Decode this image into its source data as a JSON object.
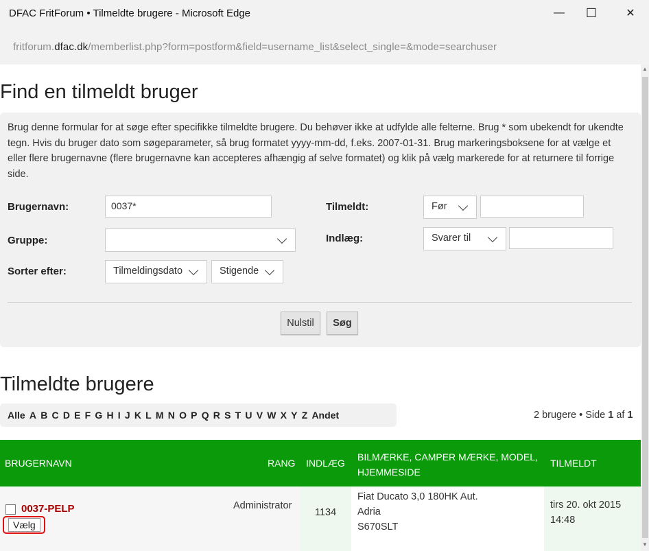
{
  "window": {
    "title": "DFAC FritForum • Tilmeldte brugere - Microsoft Edge",
    "minimize": "—",
    "maximize": "☐",
    "close": "✕"
  },
  "address": {
    "domain_prefix": "fritforum.",
    "domain": "dfac.dk",
    "path": "/memberlist.php?form=postform&field=username_list&select_single=&mode=searchuser"
  },
  "search": {
    "heading": "Find en tilmeldt bruger",
    "description": "Brug denne formular for at søge efter specifikke tilmeldte brugere. Du behøver ikke at udfylde alle felterne. Brug * som ubekendt for ukendte tegn. Hvis du bruger dato som søgeparameter, så brug formatet yyyy-mm-dd, f.eks. 2007-01-31. Brug markeringsboksene for at vælge et eller flere brugernavne (flere brugernavne kan accepteres afhængig af selve formatet) og klik på vælg markerede for at returnere til forrige side.",
    "username_label": "Brugernavn:",
    "username_value": "0037*",
    "group_label": "Gruppe:",
    "group_value": "",
    "sort_label": "Sorter efter:",
    "sort_value": "Tilmeldingsdato",
    "order_value": "Stigende",
    "joined_label": "Tilmeldt:",
    "joined_op": "Før",
    "joined_value": "",
    "posts_label": "Indlæg:",
    "posts_op": "Svarer til",
    "posts_value": "",
    "reset_button": "Nulstil",
    "search_button": "Søg"
  },
  "members": {
    "heading": "Tilmeldte brugere",
    "alphabet": [
      "Alle",
      "A",
      "B",
      "C",
      "D",
      "E",
      "F",
      "G",
      "H",
      "I",
      "J",
      "K",
      "L",
      "M",
      "N",
      "O",
      "P",
      "Q",
      "R",
      "S",
      "T",
      "U",
      "V",
      "W",
      "X",
      "Y",
      "Z",
      "Andet"
    ],
    "pager": {
      "count": "2 brugere",
      "sep": " • Side ",
      "page": "1",
      "of": " af ",
      "total": "1"
    },
    "columns": {
      "username": "BRUGERNAVN",
      "rank": "RANG",
      "posts": "INDLÆG",
      "custom": "BILMÆRKE, CAMPER MÆRKE, MODEL, HJEMMESIDE",
      "joined": "TILMELDT"
    },
    "rows": [
      {
        "username": "0037-PELP",
        "select_button": "Vælg",
        "rank": "Administrator",
        "posts": "1134",
        "custom_line1": "Fiat Ducato 3,0 180HK Aut.",
        "custom_line2": "Adria",
        "custom_line3": "S670SLT",
        "joined_line1": "tirs 20. okt 2015",
        "joined_line2": "14:48"
      }
    ]
  },
  "colors": {
    "table_header": "#0a9a0a",
    "username": "#aa0000",
    "highlight_ring": "#e01010"
  }
}
